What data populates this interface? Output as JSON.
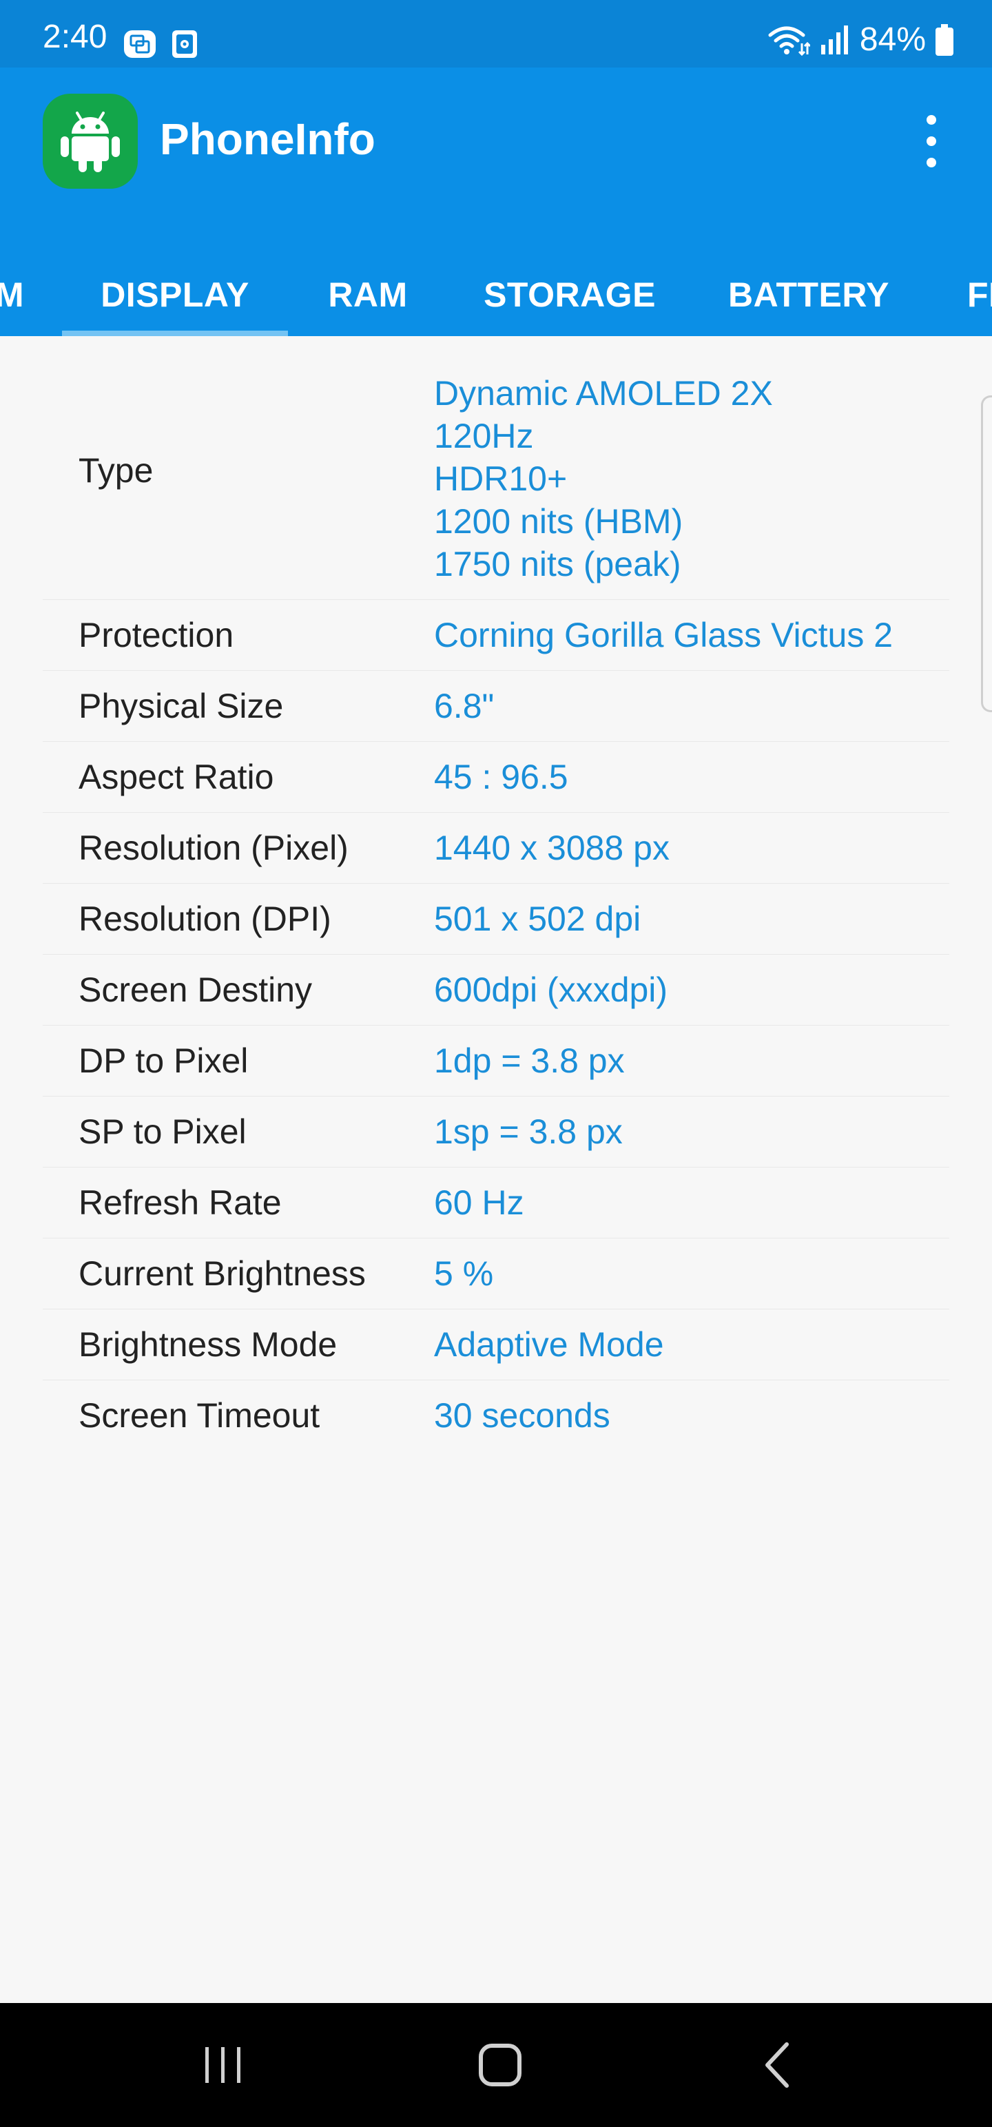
{
  "status_bar": {
    "time": "2:40",
    "battery": "84%",
    "icons": [
      "screen-mirror-icon",
      "app-notification-icon",
      "wifi-icon",
      "signal-icon",
      "battery-icon"
    ]
  },
  "app_bar": {
    "title": "PhoneInfo",
    "icon": "android-icon",
    "menu_icon": "more-vertical-icon"
  },
  "tabs": {
    "items": [
      "M",
      "DISPLAY",
      "RAM",
      "STORAGE",
      "BATTERY",
      "FI"
    ],
    "selected": "DISPLAY"
  },
  "display_info": {
    "rows": [
      {
        "label": "Type",
        "value": [
          "Dynamic AMOLED 2X",
          "120Hz",
          "HDR10+",
          "1200 nits (HBM)",
          "1750 nits (peak)"
        ]
      },
      {
        "label": "Protection",
        "value": "Corning Gorilla Glass Victus 2"
      },
      {
        "label": "Physical Size",
        "value": "6.8\""
      },
      {
        "label": "Aspect Ratio",
        "value": "45 : 96.5"
      },
      {
        "label": "Resolution (Pixel)",
        "value": "1440 x 3088 px"
      },
      {
        "label": "Resolution (DPI)",
        "value": "501 x 502 dpi"
      },
      {
        "label": "Screen Destiny",
        "value": "600dpi (xxxdpi)"
      },
      {
        "label": "DP to Pixel",
        "value": "1dp = 3.8 px"
      },
      {
        "label": "SP to Pixel",
        "value": "1sp = 3.8 px"
      },
      {
        "label": "Refresh Rate",
        "value": "60 Hz"
      },
      {
        "label": "Current Brightness",
        "value": "5 %"
      },
      {
        "label": "Brightness Mode",
        "value": "Adaptive Mode"
      },
      {
        "label": "Screen Timeout",
        "value": "30 seconds"
      }
    ]
  },
  "nav_bar": {
    "buttons": [
      "recents-icon",
      "home-icon",
      "back-icon"
    ]
  },
  "colors": {
    "status_bar": "#0b84d6",
    "app_bar": "#0b8fe6",
    "value_text": "#1a8ed8",
    "app_icon_bg": "#13a64a"
  }
}
